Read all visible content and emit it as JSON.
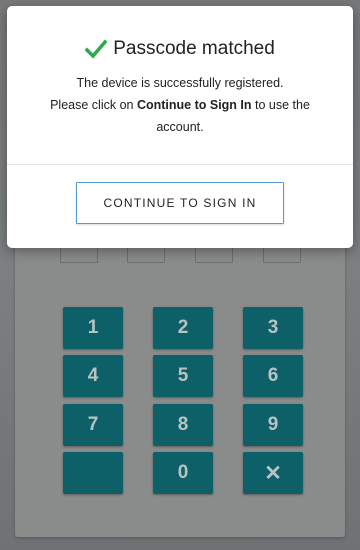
{
  "modal": {
    "title": "Passcode matched",
    "check_icon": "checkmark-icon",
    "check_color": "#2eaa4a",
    "body_line1": "The device is successfully registered.",
    "body_line2_prefix": "Please click on ",
    "body_line2_bold": "Continue to Sign In",
    "body_line2_suffix": " to use the",
    "body_line3": "account.",
    "continue_label": "CONTINUE TO SIGN IN"
  },
  "keypad": {
    "key_color": "#0d5f68",
    "keys": [
      "1",
      "2",
      "3",
      "4",
      "5",
      "6",
      "7",
      "8",
      "9",
      "",
      "0",
      "✕"
    ],
    "blank_key_label": "",
    "backspace_icon": "delete-icon"
  }
}
